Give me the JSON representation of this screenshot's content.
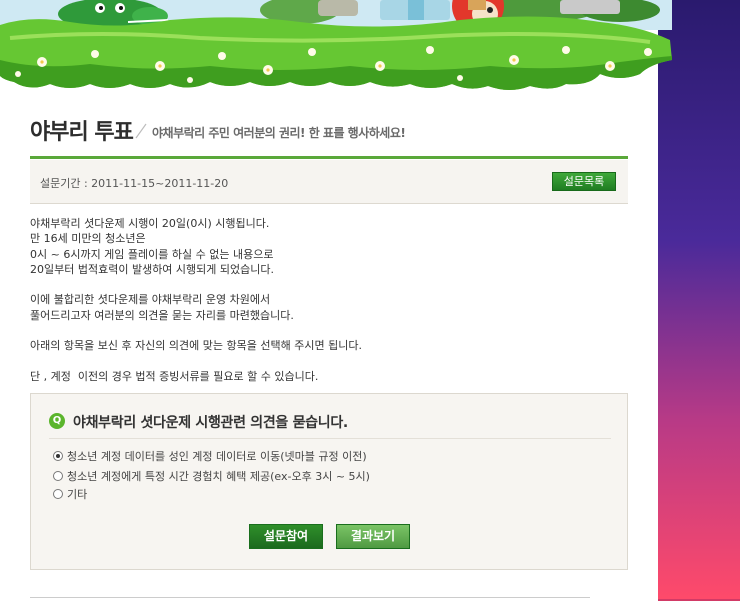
{
  "header": {
    "title": "야부리 투표",
    "subtitle": "야채부락리 주민 여러분의 권리! 한 표를 행사하세요!"
  },
  "period": {
    "label": "설문기간 : 2011-11-15~2011-11-20",
    "list_button": "설문목록"
  },
  "intro": {
    "lines": [
      "야채부락리 셧다운제 시행이 20일(0시) 시행됩니다.",
      "만 16세 미만의 청소년은",
      "0시 ~ 6시까지 게임 플레이를 하실 수 없는 내용으로",
      "20일부터 법적효력이 발생하여 시행되게 되었습니다.",
      "",
      "이에 불합리한 셧다운제를 야채부락리 운영 차원에서",
      "풀어드리고자 여러분의 의견을 묻는 자리를 마련했습니다.",
      "",
      "아래의 항목을 보신 후 자신의 의견에 맞는 항목을 선택해 주시면 됩니다.",
      "",
      "단 , 계정  이전의 경우 법적 증빙서류를 필요로 할 수 있습니다."
    ]
  },
  "poll": {
    "badge": "Q",
    "question": "야채부락리 셧다운제 시행관련 의견을 묻습니다.",
    "options": [
      {
        "label": "청소년 계정 데이터를 성인 계정 데이터로 이동(넷마블 규정 이전)",
        "selected": true
      },
      {
        "label": "청소년 계정에게 특정 시간 경험치 혜택 제공(ex-오후 3시 ~ 5시)",
        "selected": false
      },
      {
        "label": "기타",
        "selected": false
      }
    ],
    "submit_button": "설문참여",
    "result_button": "결과보기"
  },
  "colors": {
    "accent_green": "#5aa83a",
    "button_green": "#2f8f2a",
    "result_green": "#7bc466",
    "background_right_top": "#2a1a6e",
    "background_right_bottom": "#ff4a6a"
  }
}
